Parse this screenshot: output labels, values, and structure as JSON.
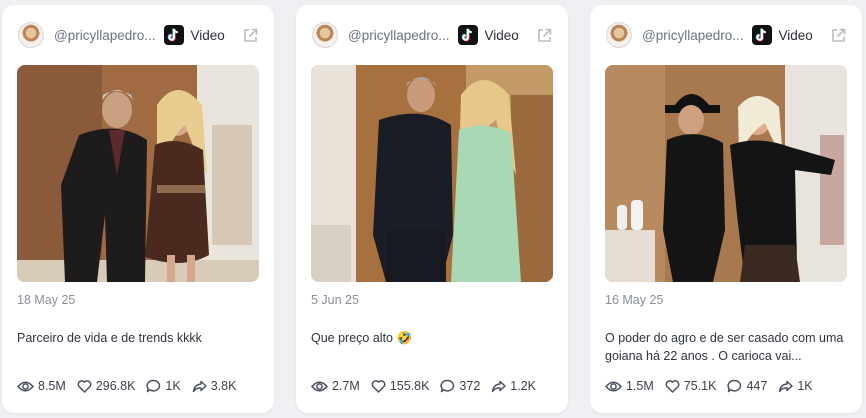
{
  "cards": [
    {
      "handle": "@pricyllapedro...",
      "platform": "Video",
      "date": "18 May 25",
      "caption": "Parceiro de vida e de trends kkkk",
      "stats": {
        "views": "8.5M",
        "likes": "296.8K",
        "comments": "1K",
        "shares": "3.8K"
      }
    },
    {
      "handle": "@pricyllapedro...",
      "platform": "Video",
      "date": "5 Jun 25",
      "caption": "Que preço alto 🤣",
      "stats": {
        "views": "2.7M",
        "likes": "155.8K",
        "comments": "372",
        "shares": "1.2K"
      }
    },
    {
      "handle": "@pricyllapedro...",
      "platform": "Video",
      "date": "16 May 25",
      "caption": "O poder do agro e de ser casado com uma goiana há 22 anos . O carioca vai...",
      "stats": {
        "views": "1.5M",
        "likes": "75.1K",
        "comments": "447",
        "shares": "1K"
      }
    }
  ],
  "icons": {
    "avatar": "avatar",
    "platform": "tiktok-icon",
    "external": "external-link-icon",
    "views": "eye-icon",
    "likes": "heart-icon",
    "comments": "comment-icon",
    "shares": "share-icon"
  },
  "colors": {
    "background": "#eef0f3",
    "card": "#ffffff",
    "muted_text": "#8a8f98",
    "body_text": "#2f3440"
  }
}
